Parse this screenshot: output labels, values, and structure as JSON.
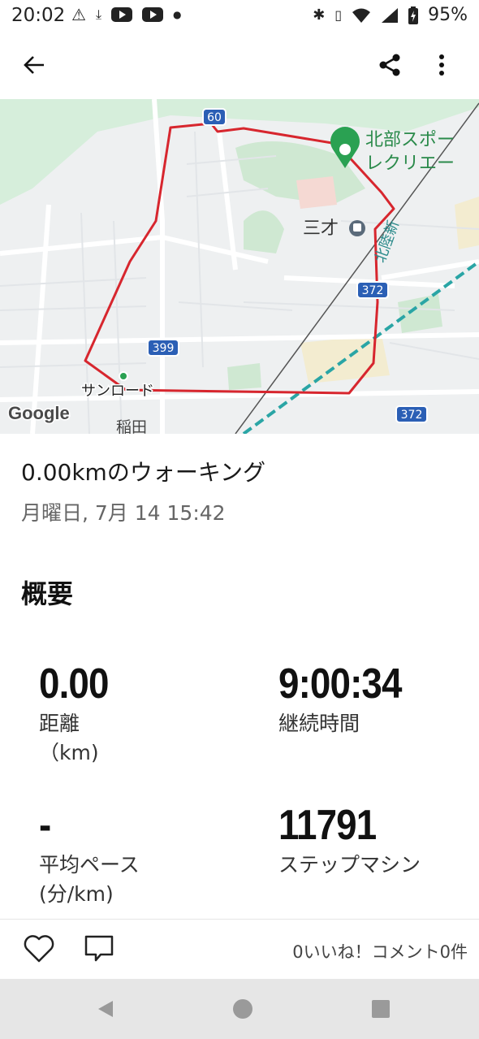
{
  "status_bar": {
    "time": "20:02",
    "battery": "95%",
    "left_icons": [
      "warning-icon",
      "download-icon",
      "youtube-icon",
      "youtube-icon",
      "dot-icon"
    ],
    "right_icons": [
      "bluetooth-icon",
      "vibrate-icon",
      "wifi-icon",
      "signal-icon",
      "battery-icon"
    ]
  },
  "app_bar": {
    "back_icon": "back-arrow-icon",
    "share_icon": "share-icon",
    "menu_icon": "more-vert-icon"
  },
  "map": {
    "labels": {
      "place_sports": "北部スポー",
      "place_recreation": "レクリエー",
      "station": "三才",
      "start_point": "サンロード",
      "area": "稲田",
      "vertical_text": "北陸新"
    },
    "route_shields": [
      "60",
      "372",
      "399",
      "372"
    ],
    "logo": "Google",
    "route_color": "#d7262e"
  },
  "activity": {
    "title": "0.00kmのウォーキング",
    "date": "月曜日, 7月 14 15:42"
  },
  "summary": {
    "heading": "概要",
    "stats": [
      {
        "value": "0.00",
        "label": "距離",
        "unit": "（km)"
      },
      {
        "value": "9:00:34",
        "label": "継続時間",
        "unit": ""
      },
      {
        "value": "-",
        "label": "平均ペース",
        "unit": "(分/km)"
      },
      {
        "value": "11791",
        "label": "ステップマシン",
        "unit": ""
      }
    ]
  },
  "actions": {
    "like_icon": "heart-icon",
    "comment_icon": "comment-icon",
    "counts": "0いいね！コメント0件"
  },
  "nav_bar": {
    "buttons": [
      "back-triangle-icon",
      "home-circle-icon",
      "recents-square-icon"
    ]
  }
}
